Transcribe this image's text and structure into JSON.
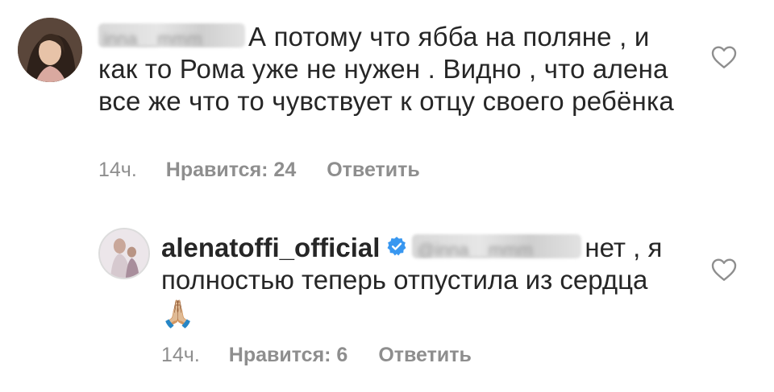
{
  "comments": [
    {
      "username_blurred": "inna__mmm",
      "text": "А потому что ябба на поляне , и как то Рома уже не нужен . Видно , что алена все же что то чувствует к отцу своего ребёнка",
      "time": "14ч.",
      "likes": "Нравится: 24",
      "reply": "Ответить",
      "avatar_icon": "user-avatar",
      "heart_icon": "heart-outline-icon"
    },
    {
      "username": "alenatoffi_official",
      "verified": true,
      "mention_blurred": "@inna__mmm",
      "text": "нет , я полностью теперь отпустила из сердца",
      "emoji": "🙏🏼",
      "time": "14ч.",
      "likes": "Нравится: 6",
      "reply": "Ответить",
      "avatar_icon": "user-avatar",
      "heart_icon": "heart-outline-icon"
    }
  ],
  "colors": {
    "text": "#262626",
    "meta": "#8e8e8e",
    "verified": "#3897f0"
  }
}
